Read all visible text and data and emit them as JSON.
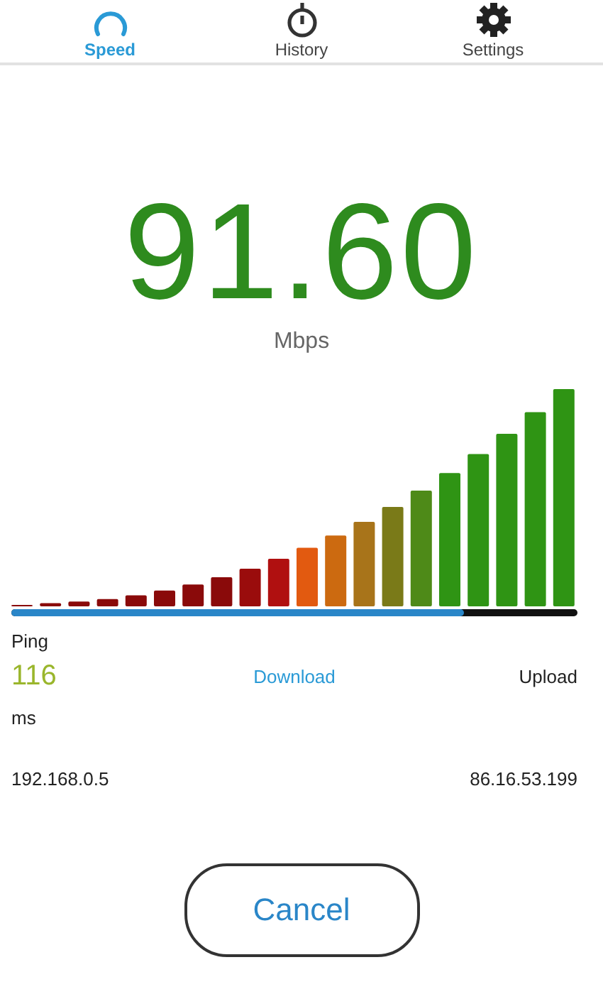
{
  "tabs": [
    {
      "label": "Speed",
      "kind": "gauge",
      "selected": true
    },
    {
      "label": "History",
      "kind": "stopwatch",
      "selected": false
    },
    {
      "label": "Settings",
      "kind": "gear",
      "selected": false
    }
  ],
  "speed": {
    "value": "91.60",
    "unit": "Mbps"
  },
  "progress": {
    "level": 0.8
  },
  "ping": {
    "label": "Ping",
    "value": "116",
    "unit": "ms"
  },
  "phases": [
    {
      "label": "Download",
      "selected": true
    },
    {
      "label": "Upload",
      "selected": false
    }
  ],
  "addresses": {
    "local": "192.168.0.5",
    "remote": "86.16.53.199"
  },
  "cancel_button": "Cancel"
}
